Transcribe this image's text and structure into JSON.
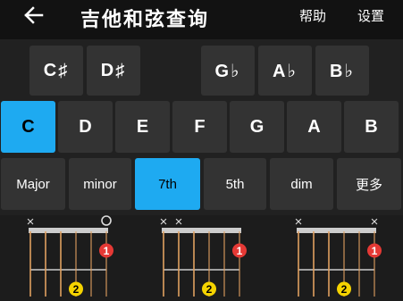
{
  "header": {
    "title": "吉他和弦查询",
    "help_label": "帮助",
    "settings_label": "设置"
  },
  "accidental_keys": [
    "C♯",
    "D♯",
    "G♭",
    "A♭",
    "B♭"
  ],
  "natural_keys": [
    "C",
    "D",
    "E",
    "F",
    "G",
    "A",
    "B"
  ],
  "selected_key": "C",
  "qualities": [
    "Major",
    "minor",
    "7th",
    "5th",
    "dim",
    "更多"
  ],
  "selected_quality": "7th",
  "colors": {
    "accent": "#1eaaf1",
    "finger_1": "#e53935",
    "finger_2": "#f5d300",
    "string": "#e0a060",
    "fret": "#cccccc"
  },
  "diagrams": [
    {
      "name": "diagram-1",
      "markers": [
        "×",
        "",
        "",
        "",
        "",
        "○"
      ],
      "fingers": [
        {
          "string": 5,
          "fret": 1,
          "label": "1"
        },
        {
          "string": 3,
          "fret": 2,
          "label": "2"
        }
      ]
    },
    {
      "name": "diagram-2",
      "markers": [
        "×",
        "×",
        "",
        "",
        "",
        ""
      ],
      "fingers": [
        {
          "string": 5,
          "fret": 1,
          "label": "1"
        },
        {
          "string": 3,
          "fret": 2,
          "label": "2"
        }
      ]
    },
    {
      "name": "diagram-3",
      "markers": [
        "×",
        "",
        "",
        "",
        "",
        "×"
      ],
      "fingers": [
        {
          "string": 5,
          "fret": 1,
          "label": "1"
        },
        {
          "string": 3,
          "fret": 2,
          "label": "2"
        }
      ]
    }
  ]
}
